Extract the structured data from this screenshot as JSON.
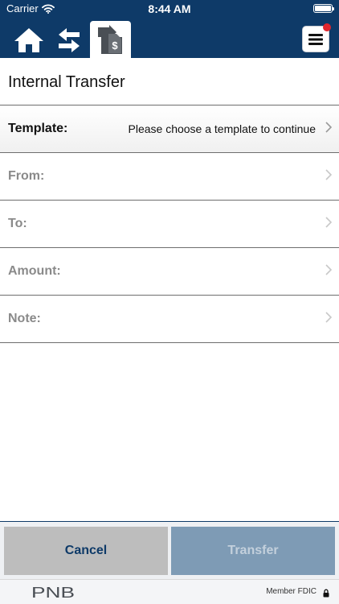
{
  "status_bar": {
    "carrier": "Carrier",
    "time": "8:44 AM"
  },
  "nav": {
    "icons": [
      "home-icon",
      "transfer-arrows-icon",
      "internal-transfer-icon",
      "hamburger-menu-icon"
    ],
    "has_notification": true
  },
  "page": {
    "title": "Internal Transfer"
  },
  "form": {
    "template": {
      "label": "Template:",
      "value": "Please choose a template to continue"
    },
    "from": {
      "label": "From:"
    },
    "to": {
      "label": "To:"
    },
    "amount": {
      "label": "Amount:"
    },
    "note": {
      "label": "Note:"
    }
  },
  "buttons": {
    "cancel": "Cancel",
    "transfer": "Transfer"
  },
  "footer": {
    "logo_text": "PNB",
    "fdic": "Member FDIC"
  },
  "colors": {
    "brand_navy": "#0e3a68",
    "notification_red": "#e0262d",
    "cancel_bg": "#bdbdbd",
    "transfer_disabled_bg": "#7e9bb5"
  }
}
